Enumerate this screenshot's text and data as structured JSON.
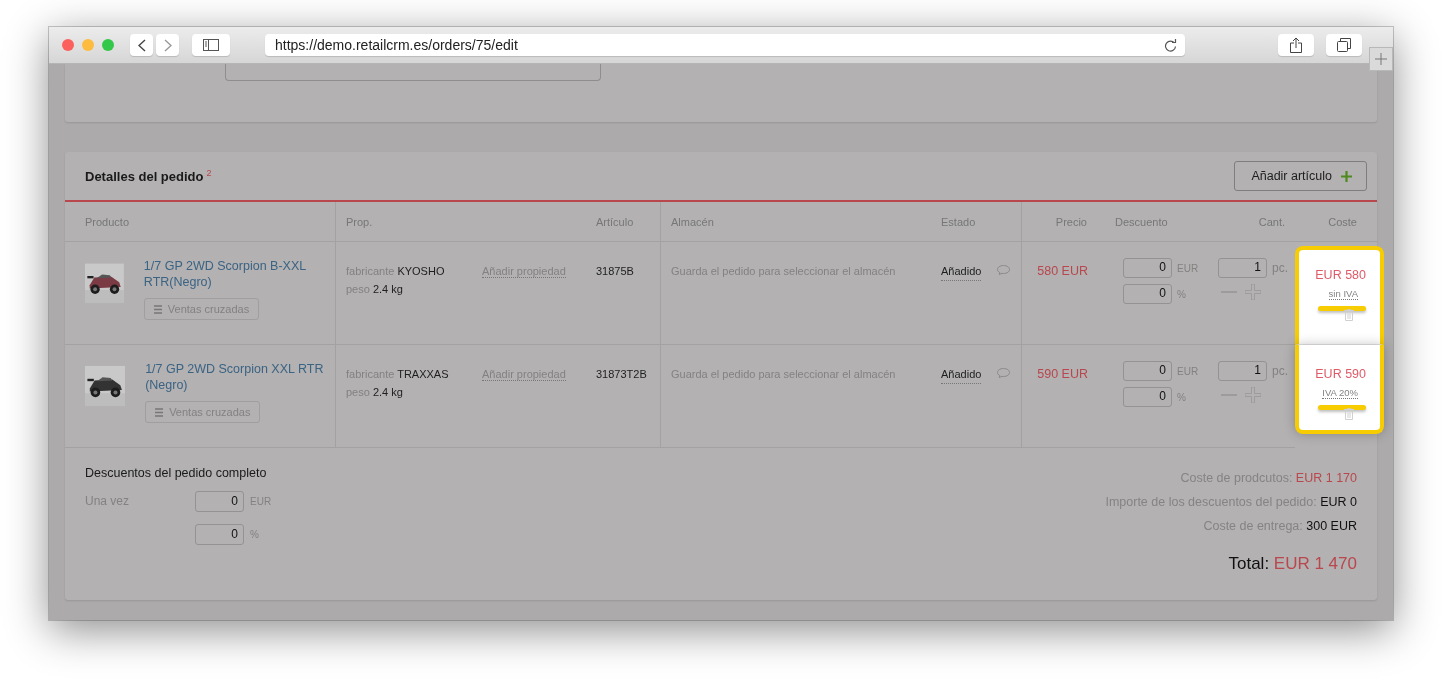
{
  "browser": {
    "url": "https://demo.retailcrm.es/orders/75/edit"
  },
  "order_details": {
    "title": "Detalles del pedido",
    "count": "2",
    "add_button": "Añadir artículo"
  },
  "columns": [
    "Producto",
    "Prop.",
    "Artículo",
    "Almacén",
    "Estado",
    "Precio",
    "Descuento",
    "Cant.",
    "Coste"
  ],
  "rows": [
    {
      "product": "1/7 GP 2WD Scorpion B-XXL RTR(Negro)",
      "cross_sell": "Ventas cruzadas",
      "properties": [
        {
          "name": "fabricante",
          "value": "KYOSHO"
        },
        {
          "name": "peso",
          "value": "2.4 kg"
        }
      ],
      "add_property": "Añadir propiedad",
      "sku": "31875B",
      "warehouse": "Guarda el pedido para seleccionar el almacén",
      "status": "Añadido",
      "price": "580 EUR",
      "discount_amount": "0",
      "discount_currency": "EUR",
      "discount_percent": "0",
      "percent_sign": "%",
      "quantity": "1",
      "unit": "pc.",
      "cost": "EUR 580",
      "tax": "sin IVA",
      "highlighted": true
    },
    {
      "product": "1/7 GP 2WD Scorpion XXL RTR (Negro)",
      "cross_sell": "Ventas cruzadas",
      "properties": [
        {
          "name": "fabricante",
          "value": "TRAXXAS"
        },
        {
          "name": "peso",
          "value": "2.4 kg"
        }
      ],
      "add_property": "Añadir propiedad",
      "sku": "31873T2B",
      "warehouse": "Guarda el pedido para seleccionar el almacén",
      "status": "Añadido",
      "price": "590 EUR",
      "discount_amount": "0",
      "discount_currency": "EUR",
      "discount_percent": "0",
      "percent_sign": "%",
      "quantity": "1",
      "unit": "pc.",
      "cost": "EUR 590",
      "tax": "IVA 20%",
      "highlighted": true
    }
  ],
  "order_discounts": {
    "title": "Descuentos del pedido completo",
    "label": "Una vez",
    "amount": "0",
    "currency": "EUR",
    "percent": "0",
    "percent_sign": "%"
  },
  "totals": [
    {
      "label": "Coste de prodcutos:",
      "value": "EUR 1 170",
      "kind": "accent"
    },
    {
      "label": "Importe de los descuentos del pedido:",
      "value": "EUR 0",
      "kind": "plain"
    },
    {
      "label": "Coste de entrega:",
      "value": "300 EUR",
      "kind": "plain"
    }
  ],
  "total": {
    "label": "Total:",
    "value": "EUR 1 470"
  }
}
